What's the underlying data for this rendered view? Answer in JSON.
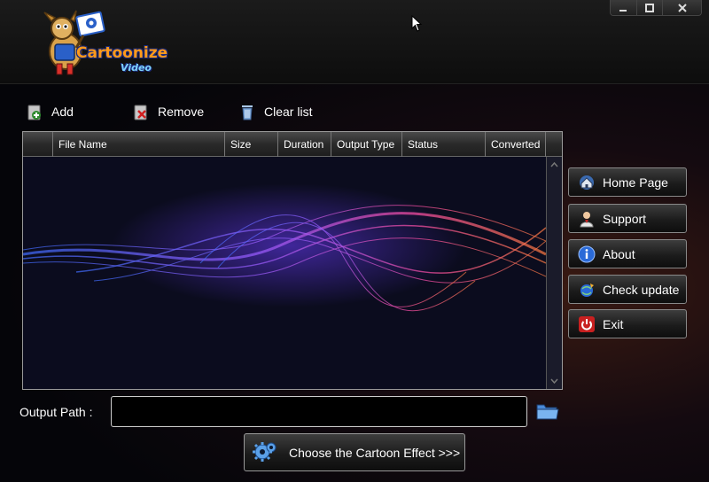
{
  "app": {
    "logo_text": "Cartoonize",
    "logo_sub": "Video"
  },
  "window_controls": {
    "minimize_icon": "minimize-icon",
    "maximize_icon": "maximize-icon",
    "close_icon": "close-icon"
  },
  "toolbar": {
    "add_label": "Add",
    "remove_label": "Remove",
    "clear_label": "Clear list"
  },
  "file_list": {
    "columns": [
      "File Name",
      "Size",
      "Duration",
      "Output Type",
      "Status",
      "Converted"
    ],
    "rows": []
  },
  "side_buttons": {
    "home": "Home Page",
    "support": "Support",
    "about": "About",
    "update": "Check update",
    "exit": "Exit"
  },
  "output": {
    "label": "Output Path :",
    "value": "",
    "placeholder": ""
  },
  "effect_button": {
    "label": "Choose the Cartoon Effect >>>"
  },
  "colors": {
    "accent_orange": "#ff9a1a",
    "accent_blue": "#1a2a7a",
    "wave_blue": "#3f6cff",
    "wave_purple": "#9a5cff",
    "wave_pink": "#ff4fa8"
  }
}
